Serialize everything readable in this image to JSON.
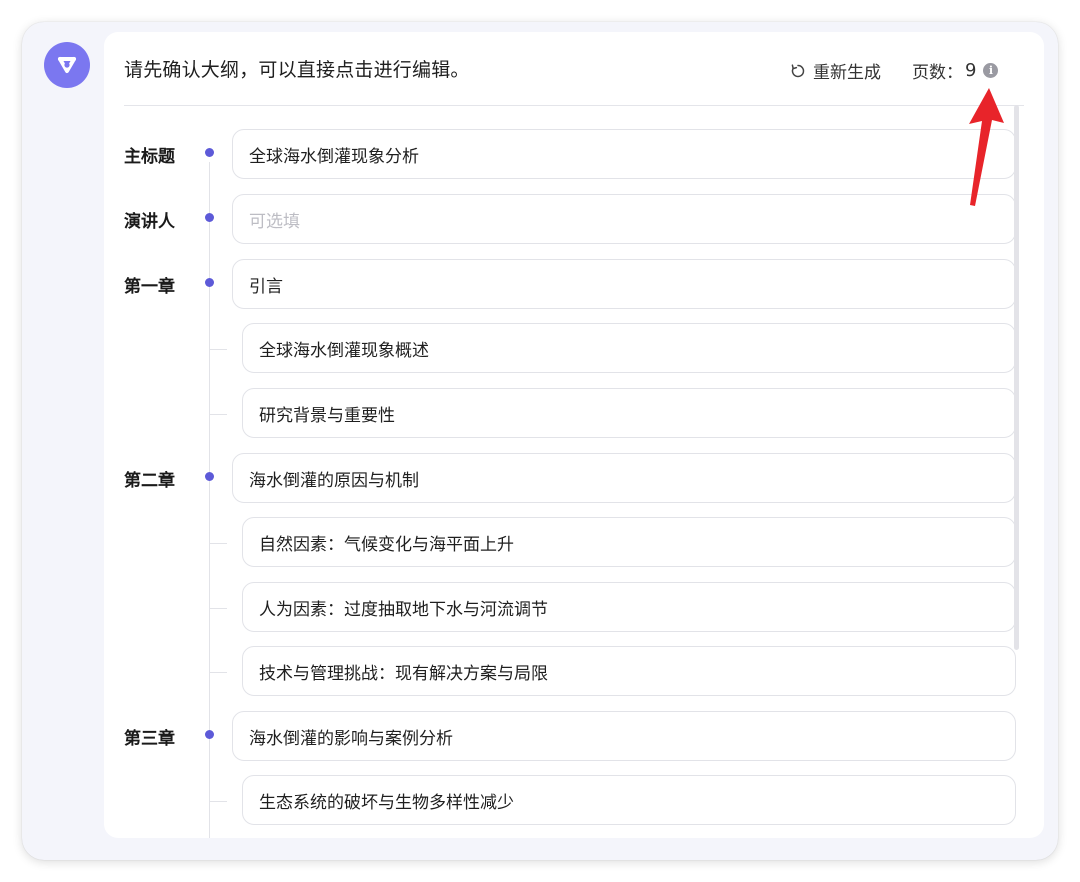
{
  "header": {
    "title": "请先确认大纲，可以直接点击进行编辑。",
    "regenerate_label": "重新生成",
    "page_count_label": "页数：",
    "page_count_value": "9"
  },
  "outline": {
    "title_label": "主标题",
    "title_value": "全球海水倒灌现象分析",
    "speaker_label": "演讲人",
    "speaker_placeholder": "可选填",
    "chapters": [
      {
        "label": "第一章",
        "title": "引言",
        "sections": [
          "全球海水倒灌现象概述",
          "研究背景与重要性"
        ]
      },
      {
        "label": "第二章",
        "title": "海水倒灌的原因与机制",
        "sections": [
          "自然因素：气候变化与海平面上升",
          "人为因素：过度抽取地下水与河流调节",
          "技术与管理挑战：现有解决方案与局限"
        ]
      },
      {
        "label": "第三章",
        "title": "海水倒灌的影响与案例分析",
        "sections": [
          "生态系统的破坏与生物多样性减少"
        ]
      }
    ]
  },
  "colors": {
    "accent": "#5d5ad8",
    "avatar_bg": "#7b77f0",
    "annotation_arrow": "#e8242a"
  },
  "icons": {
    "avatar": "assistant-logo-icon",
    "regenerate": "refresh-icon",
    "info": "info-icon",
    "annotation": "red-arrow-icon"
  }
}
